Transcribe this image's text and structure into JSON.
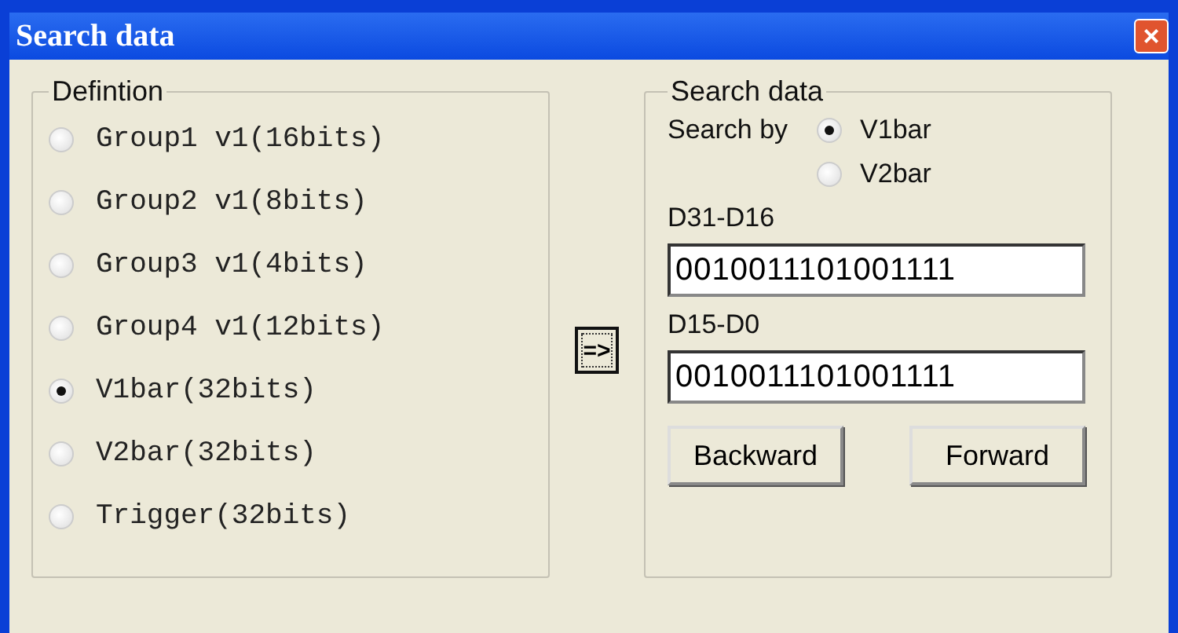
{
  "window": {
    "title": "Search data",
    "close": "×"
  },
  "definition": {
    "title": "Defintion",
    "options": [
      {
        "label": "Group1 v1(16bits)",
        "selected": false
      },
      {
        "label": "Group2 v1(8bits)",
        "selected": false
      },
      {
        "label": "Group3 v1(4bits)",
        "selected": false
      },
      {
        "label": "Group4 v1(12bits)",
        "selected": false
      },
      {
        "label": "V1bar(32bits)",
        "selected": true
      },
      {
        "label": "V2bar(32bits)",
        "selected": false
      },
      {
        "label": "Trigger(32bits)",
        "selected": false
      }
    ]
  },
  "transfer_button": "=>",
  "search_data": {
    "title": "Search data",
    "search_by_label": "Search by",
    "search_by": [
      {
        "label": "V1bar",
        "selected": true
      },
      {
        "label": "V2bar",
        "selected": false
      }
    ],
    "fields": [
      {
        "label": "D31-D16",
        "value": "0010011101001111"
      },
      {
        "label": "D15-D0",
        "value": "0010011101001111"
      }
    ],
    "buttons": [
      "Backward",
      "Forward"
    ]
  }
}
